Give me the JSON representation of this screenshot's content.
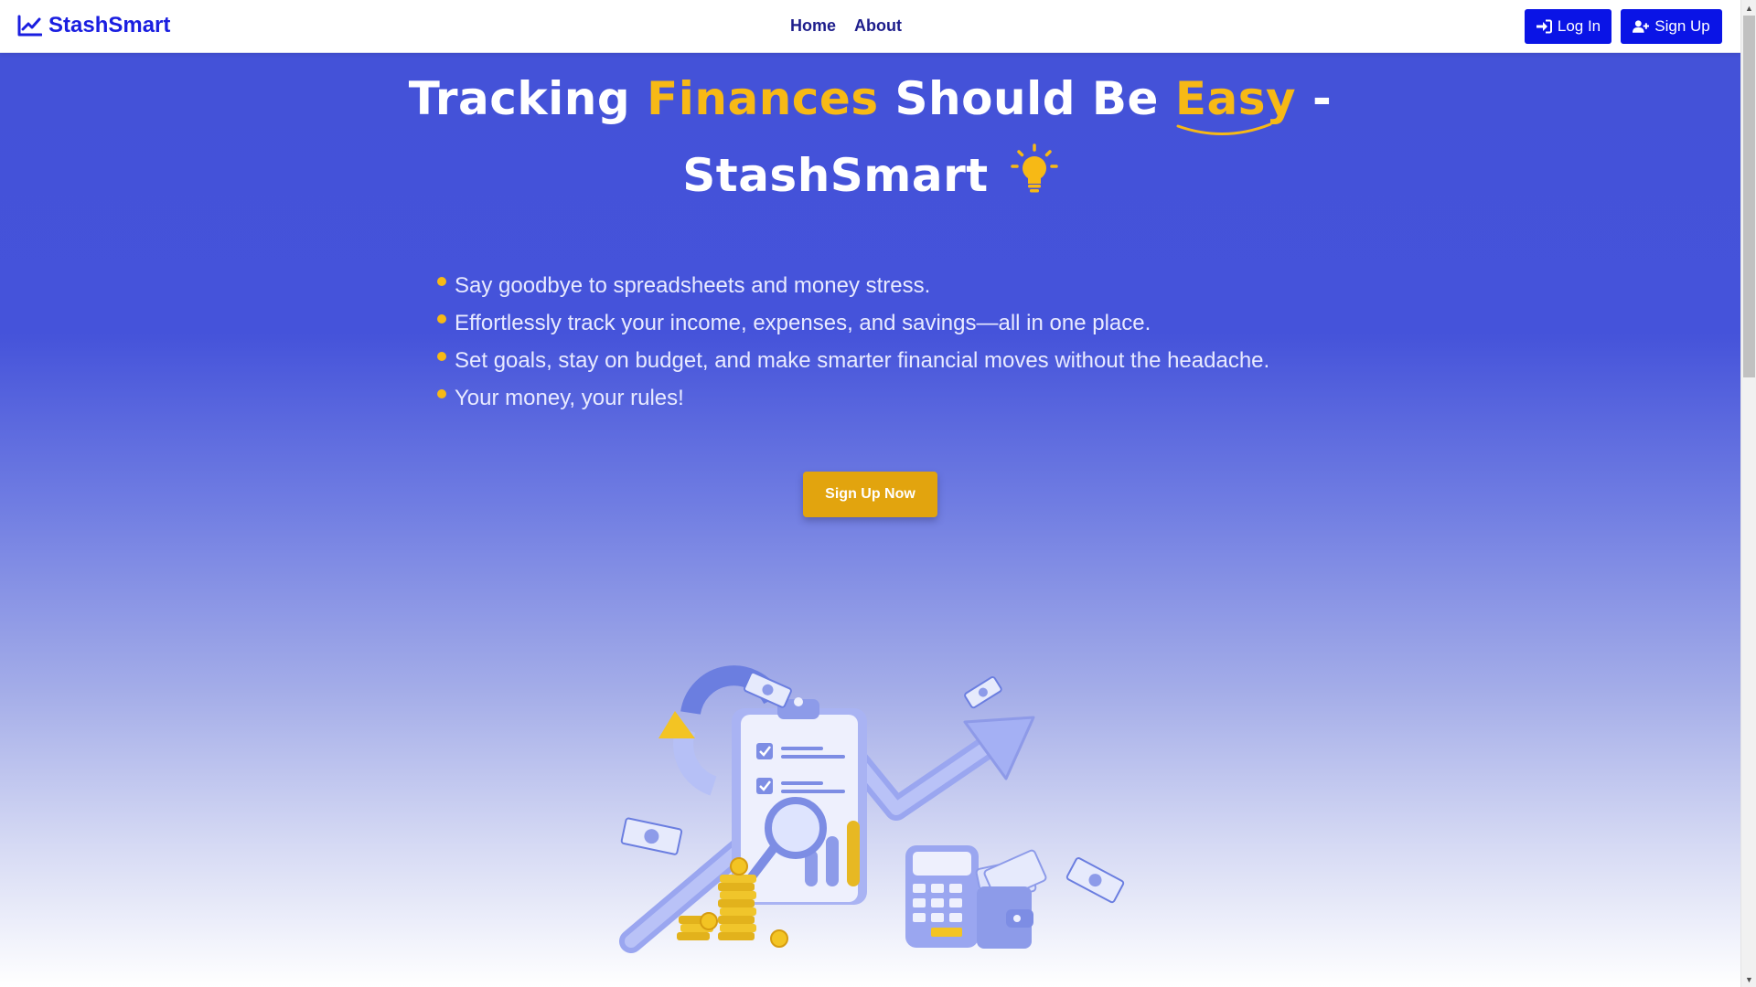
{
  "app": {
    "brand": "StashSmart"
  },
  "nav": {
    "links": [
      {
        "label": "Home"
      },
      {
        "label": "About"
      }
    ],
    "login_label": "Log In",
    "signup_label": "Sign Up"
  },
  "hero": {
    "headline": {
      "part1": "Tracking ",
      "accent1": "Finances",
      "part2": " Should Be ",
      "accent2": "Easy",
      "part3": " -",
      "line2": "StashSmart"
    },
    "features": [
      "Say goodbye to spreadsheets and money stress.",
      "Effortlessly track your income, expenses, and savings—all in one place.",
      "Set goals, stay on budget, and make smarter financial moves without the headache.",
      "Your money, your rules!"
    ],
    "cta_label": "Sign Up Now"
  },
  "colors": {
    "brand": "#1a1ee0",
    "hero_top": "#4452d8",
    "accent": "#f7b915",
    "cta": "#e2a40e",
    "button": "#0a14e6"
  },
  "icons": {
    "brand_icon": "line-chart-icon",
    "login_icon": "sign-in-icon",
    "signup_icon": "user-plus-icon",
    "bulb_icon": "lightbulb-icon",
    "scroll_icon": "chevron-down-icon"
  }
}
